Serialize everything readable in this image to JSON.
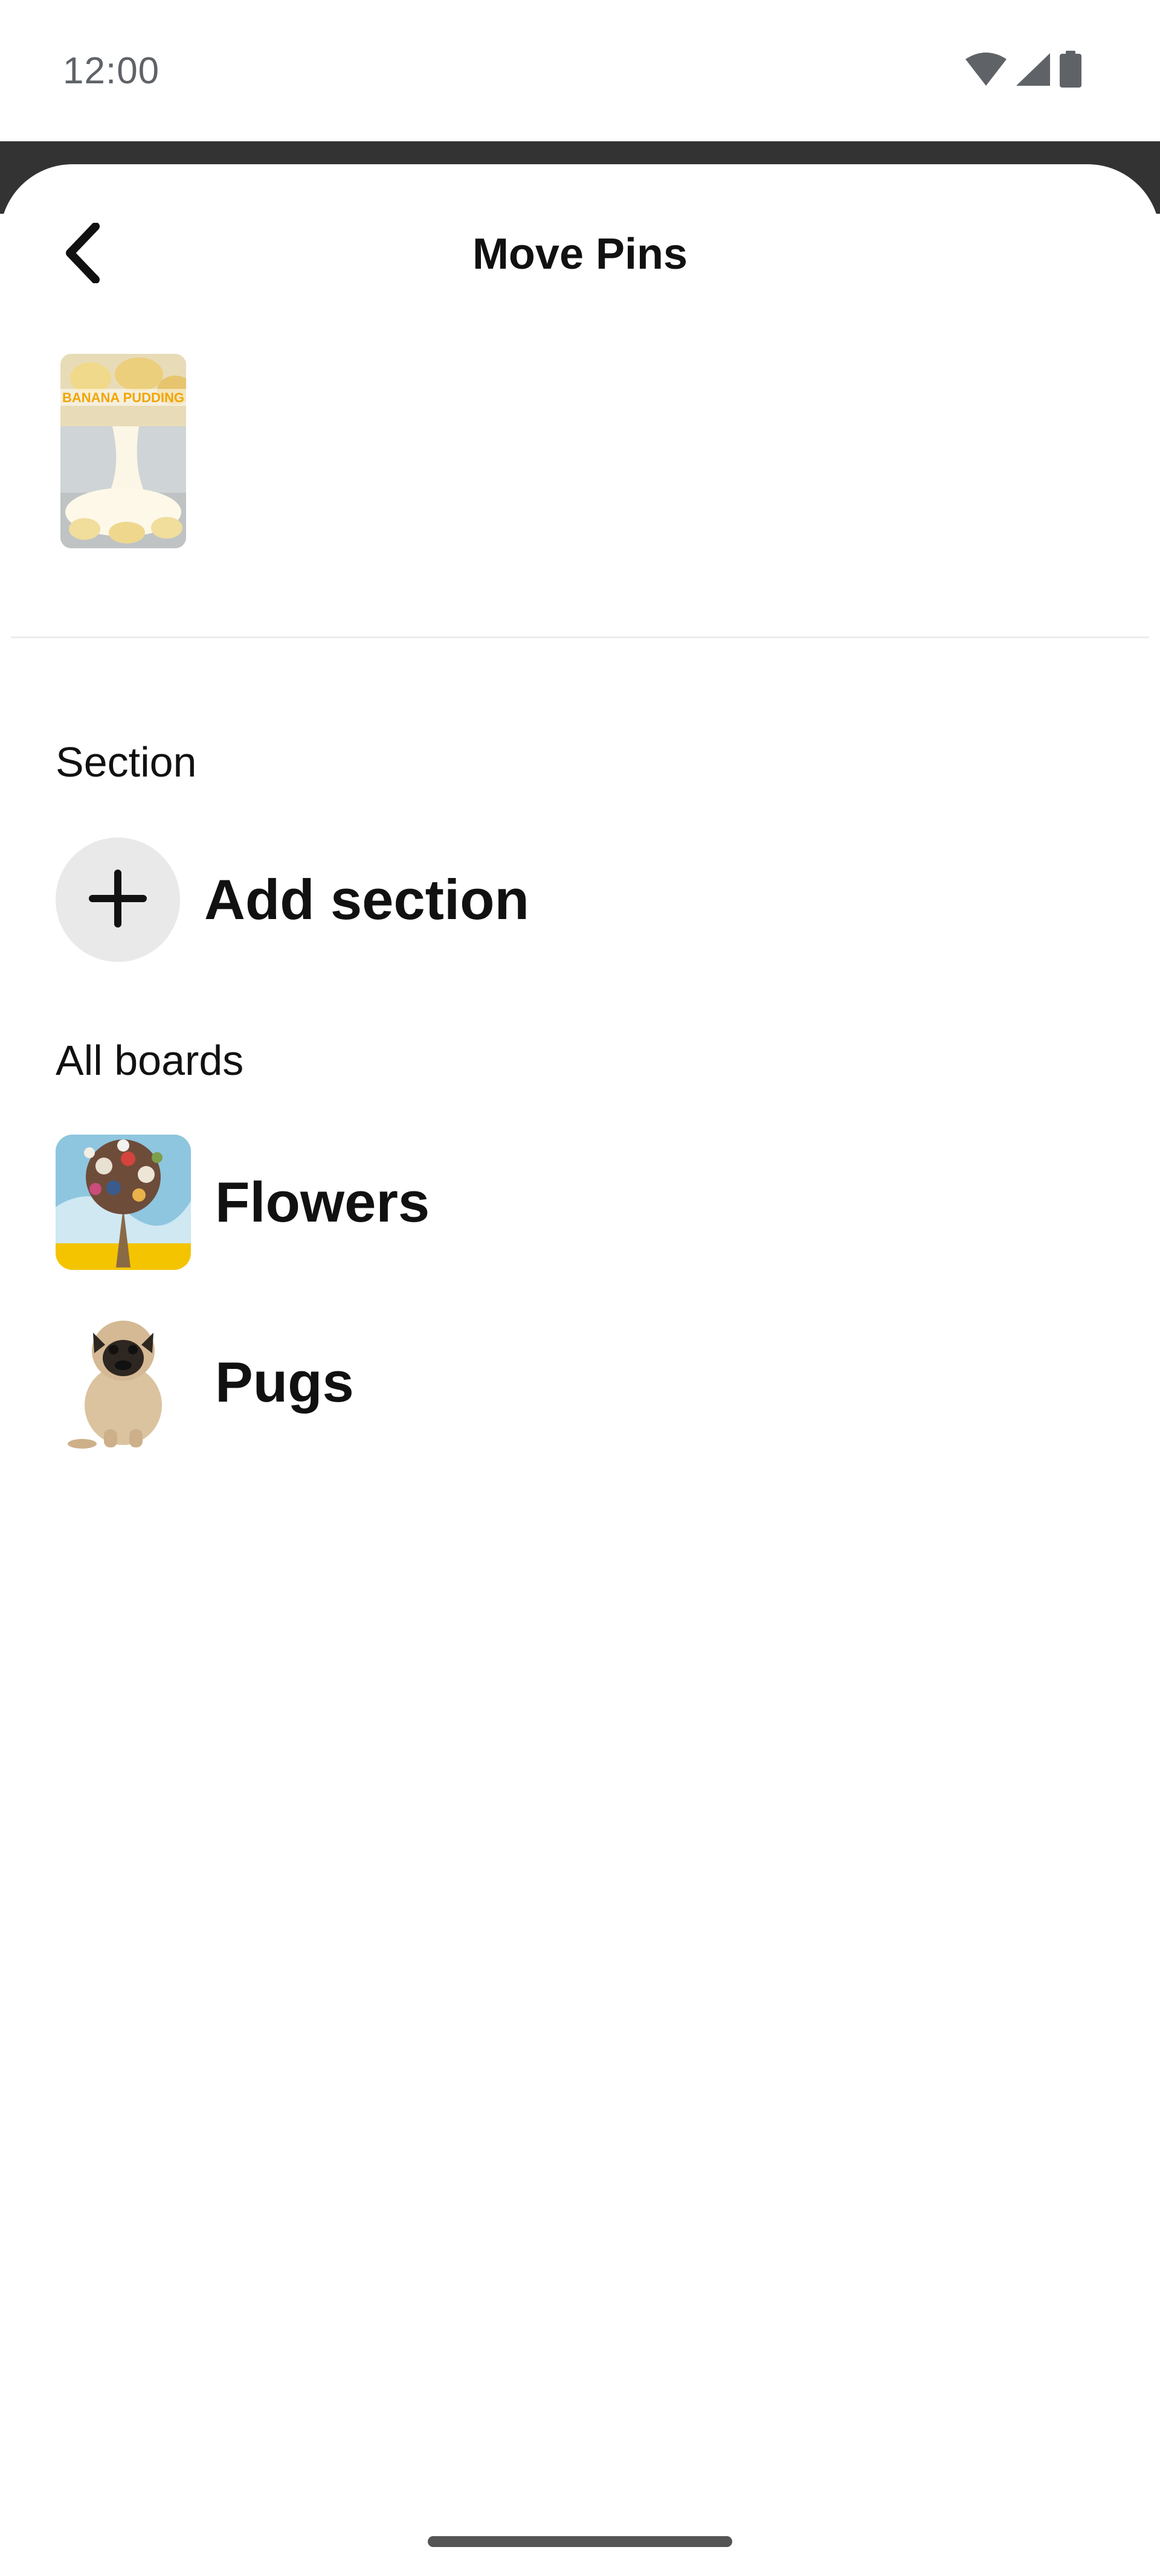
{
  "status_bar": {
    "time": "12:00",
    "icons": [
      "wifi-icon",
      "cellular-signal-icon",
      "battery-icon"
    ],
    "color": "#5f6368"
  },
  "header": {
    "title": "Move Pins",
    "back_icon": "chevron-left-icon"
  },
  "selected_pin": {
    "thumbnail_alt": "BANANA PUDDING"
  },
  "section": {
    "heading": "Section",
    "add_label": "Add section",
    "add_icon": "plus-icon"
  },
  "boards": {
    "heading": "All boards",
    "items": [
      {
        "label": "Flowers",
        "thumbnail": "flowers-bouquet-image"
      },
      {
        "label": "Pugs",
        "thumbnail": "pug-dog-image"
      }
    ]
  },
  "colors": {
    "background": "#ffffff",
    "text": "#111111",
    "add_circle_bg": "#e9e9e9",
    "overlay_strip": "#333333",
    "divider": "#ececec"
  }
}
